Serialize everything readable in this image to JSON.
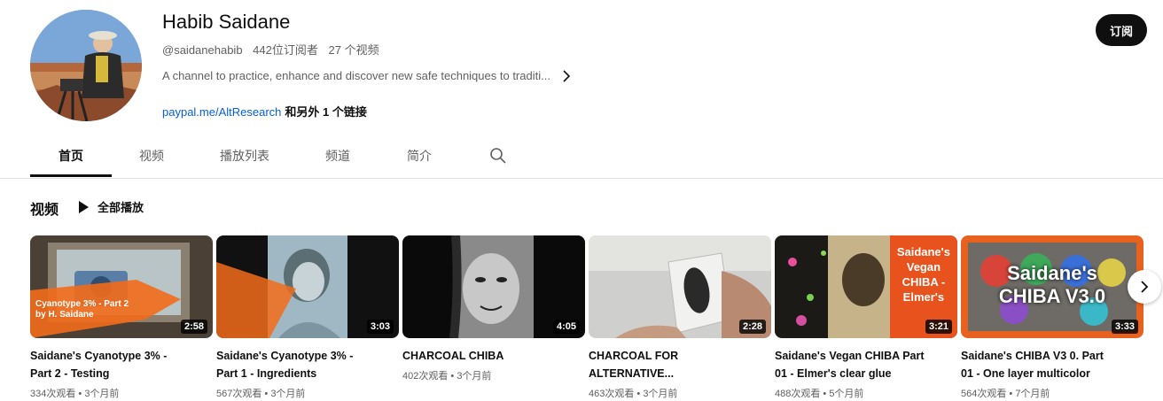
{
  "channel": {
    "name": "Habib Saidane",
    "handle": "@saidanehabib",
    "subscribers": "442位订阅者",
    "video_count": "27 个视频",
    "description": "A channel to practice, enhance and discover new safe techniques to traditi...",
    "link_text": "paypal.me/AltResearch",
    "more_links": "和另外 1 个链接",
    "subscribe_label": "订阅"
  },
  "tabs": [
    {
      "label": "首页",
      "active": true
    },
    {
      "label": "视频"
    },
    {
      "label": "播放列表"
    },
    {
      "label": "频道"
    },
    {
      "label": "简介"
    }
  ],
  "section": {
    "title": "视频",
    "play_all_label": "全部播放"
  },
  "videos": [
    {
      "title_line1": "Saidane's Cyanotype 3% -",
      "title_line2": "Part 2 - Testing",
      "meta": "334次观看 • 3个月前",
      "duration": "2:58",
      "thumb_text_1": "Cyanotype 3% - Part 2",
      "thumb_text_2": "by H. Saidane"
    },
    {
      "title_line1": "Saidane's Cyanotype 3% -",
      "title_line2": "Part 1 - Ingredients",
      "meta": "567次观看 • 3个月前",
      "duration": "3:03"
    },
    {
      "title_line1": "CHARCOAL CHIBA",
      "title_line2": "",
      "meta": "402次观看 • 3个月前",
      "duration": "4:05"
    },
    {
      "title_line1": "CHARCOAL FOR",
      "title_line2": "ALTERNATIVE...",
      "meta": "463次观看 • 3个月前",
      "duration": "2:28"
    },
    {
      "title_line1": "Saidane's Vegan CHIBA Part",
      "title_line2": "01 - Elmer's clear glue",
      "meta": "488次观看 • 5个月前",
      "duration": "3:21",
      "thumb_text_1": "Saidane's",
      "thumb_text_2": "Vegan",
      "thumb_text_3": "CHIBA -",
      "thumb_text_4": "Elmer's"
    },
    {
      "title_line1": "Saidane's CHIBA V3 0. Part",
      "title_line2": "01 - One layer multicolor",
      "meta": "564次观看 • 7个月前",
      "duration": "3:33",
      "thumb_text_1": "Saidane's",
      "thumb_text_2": "CHIBA V3.0"
    }
  ],
  "icons": {
    "search": "search-icon",
    "chevron": "chevron-right-icon",
    "play": "play-icon",
    "next": "next-arrow-icon"
  }
}
